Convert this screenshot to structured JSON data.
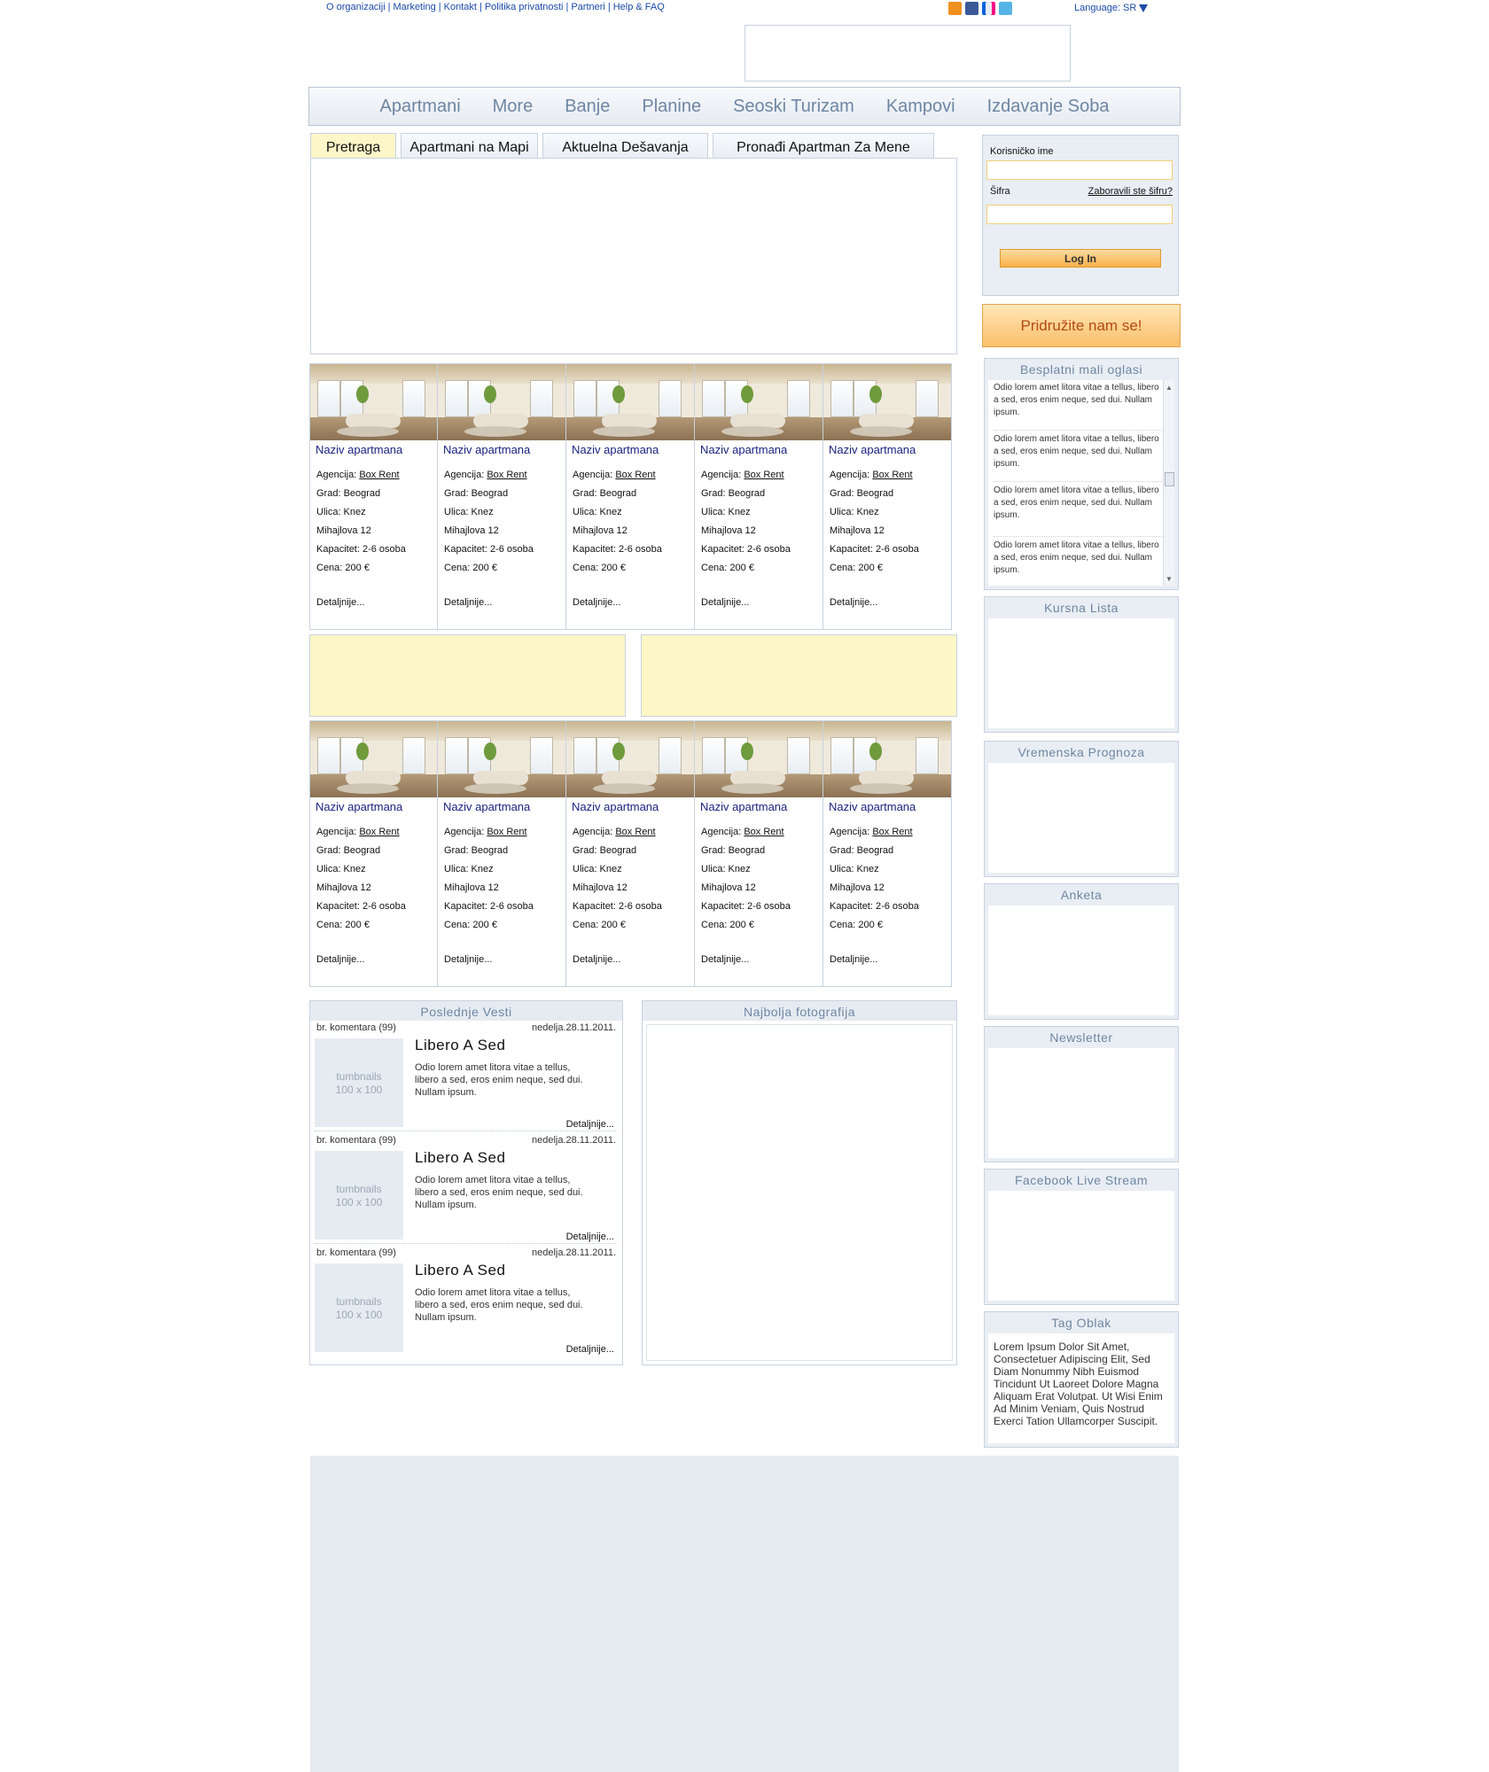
{
  "top_links": [
    "O organizaciji",
    "Marketing",
    "Kontakt",
    "Politika privatnosti",
    "Partneri",
    "Help & FAQ"
  ],
  "social_icons": [
    "rss-icon",
    "facebook-icon",
    "flickr-icon",
    "twitter-icon"
  ],
  "language": {
    "label": "Language: SR"
  },
  "nav": [
    "Apartmani",
    "More",
    "Banje",
    "Planine",
    "Seoski Turizam",
    "Kampovi",
    "Izdavanje Soba"
  ],
  "tabs": [
    {
      "label": "Pretraga",
      "active": true
    },
    {
      "label": "Apartmani na Mapi",
      "active": false
    },
    {
      "label": "Aktuelna Dešavanja",
      "active": false
    },
    {
      "label": "Pronađi Apartman Za Mene",
      "active": false
    }
  ],
  "card_labels": {
    "title": "Naziv apartmana",
    "agency_label": "Agencija:",
    "agency_link": "Box Rent",
    "city": "Grad: Beograd",
    "street": "Ulica: Knez",
    "street2": "Mihajlova 12",
    "capacity": "Kapacitet: 2-6 osoba",
    "price": "Cena: 200 €",
    "more": "Detaljnije..."
  },
  "cards_per_row": 5,
  "news": {
    "title": "Poslednje Vesti",
    "items": [
      {
        "comments": "br. komentara (99)",
        "date": "nedelja.28.11.2011.",
        "thumb": "tumbnails\n100 x 100",
        "title": "Libero A Sed",
        "text": "Odio lorem amet litora vitae a tellus, libero a sed, eros enim neque, sed dui. Nullam ipsum.",
        "more": "Detaljnije..."
      },
      {
        "comments": "br. komentara (99)",
        "date": "nedelja.28.11.2011.",
        "thumb": "tumbnails\n100 x 100",
        "title": "Libero A Sed",
        "text": "Odio lorem amet litora vitae a tellus, libero a sed, eros enim neque, sed dui. Nullam ipsum.",
        "more": "Detaljnije..."
      },
      {
        "comments": "br. komentara (99)",
        "date": "nedelja.28.11.2011.",
        "thumb": "tumbnails\n100 x 100",
        "title": "Libero A Sed",
        "text": "Odio lorem amet litora vitae a tellus, libero a sed, eros enim neque, sed dui. Nullam ipsum.",
        "more": "Detaljnije..."
      }
    ]
  },
  "best_photo": {
    "title": "Najbolja fotografija"
  },
  "login": {
    "username_label": "Korisničko ime",
    "password_label": "Šifra",
    "forgot": "Zaboravili ste šifru?",
    "button": "Log In"
  },
  "join_button": "Pridružite nam se!",
  "small_ads": {
    "title": "Besplatni mali oglasi",
    "items": [
      "Odio lorem amet litora vitae a tellus, libero a sed, eros enim neque, sed dui. Nullam ipsum.",
      "Odio lorem amet litora vitae a tellus, libero a sed, eros enim neque, sed dui. Nullam ipsum.",
      "Odio lorem amet litora vitae a tellus, libero a sed, eros enim neque, sed dui. Nullam ipsum.",
      "Odio lorem amet litora vitae a tellus, libero a sed, eros enim neque, sed dui. Nullam ipsum."
    ]
  },
  "widgets": [
    "Kursna Lista",
    "Vremenska Prognoza",
    "Anketa",
    "Newsletter",
    "Facebook Live Stream"
  ],
  "tag_cloud": {
    "title": "Tag Oblak",
    "text": "Lorem Ipsum Dolor Sit Amet, Consectetuer Adipiscing Elit, Sed Diam Nonummy Nibh Euismod Tincidunt Ut Laoreet Dolore Magna Aliquam Erat Volutpat. Ut Wisi Enim Ad Minim Veniam, Quis Nostrud Exerci Tation Ullamcorper Suscipit."
  },
  "colors": {
    "accent": "#1b4aa8",
    "nav_text": "#6f86a3",
    "panel_bg": "#e9eef4",
    "ad_yellow": "#fdf6c6",
    "join_orange": "#fbbf6c"
  }
}
